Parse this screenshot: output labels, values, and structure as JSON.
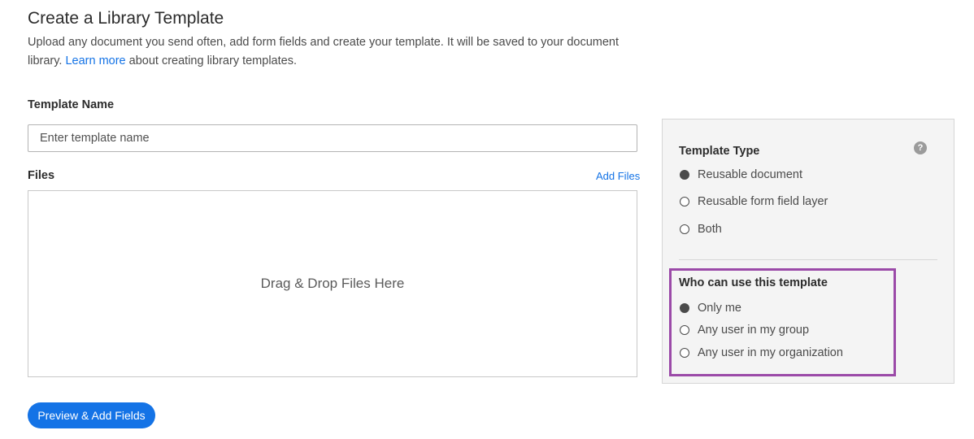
{
  "header": {
    "title": "Create a Library Template",
    "description_part1": "Upload any document you send often, add form fields and create your template. It will be saved to your document library.",
    "learn_more_link": "Learn more",
    "description_part2": "about creating library templates."
  },
  "form": {
    "template_name_label": "Template Name",
    "template_name_placeholder": "Enter template name",
    "template_name_value": "",
    "files_label": "Files",
    "add_files_link": "Add Files",
    "dropzone_text": "Drag & Drop Files Here",
    "preview_button": "Preview & Add Fields"
  },
  "sidebar": {
    "template_type": {
      "title": "Template Type",
      "help_icon": "question-circle-icon",
      "options": [
        {
          "label": "Reusable document",
          "selected": true
        },
        {
          "label": "Reusable form field layer",
          "selected": false
        },
        {
          "label": "Both",
          "selected": false
        }
      ]
    },
    "access": {
      "title": "Who can use this template",
      "options": [
        {
          "label": "Only me",
          "selected": true
        },
        {
          "label": "Any user in my group",
          "selected": false
        },
        {
          "label": "Any user in my organization",
          "selected": false
        }
      ]
    }
  },
  "colors": {
    "accent": "#1473e6",
    "highlight": "#9b4aa8",
    "panel_bg": "#f4f4f4"
  }
}
